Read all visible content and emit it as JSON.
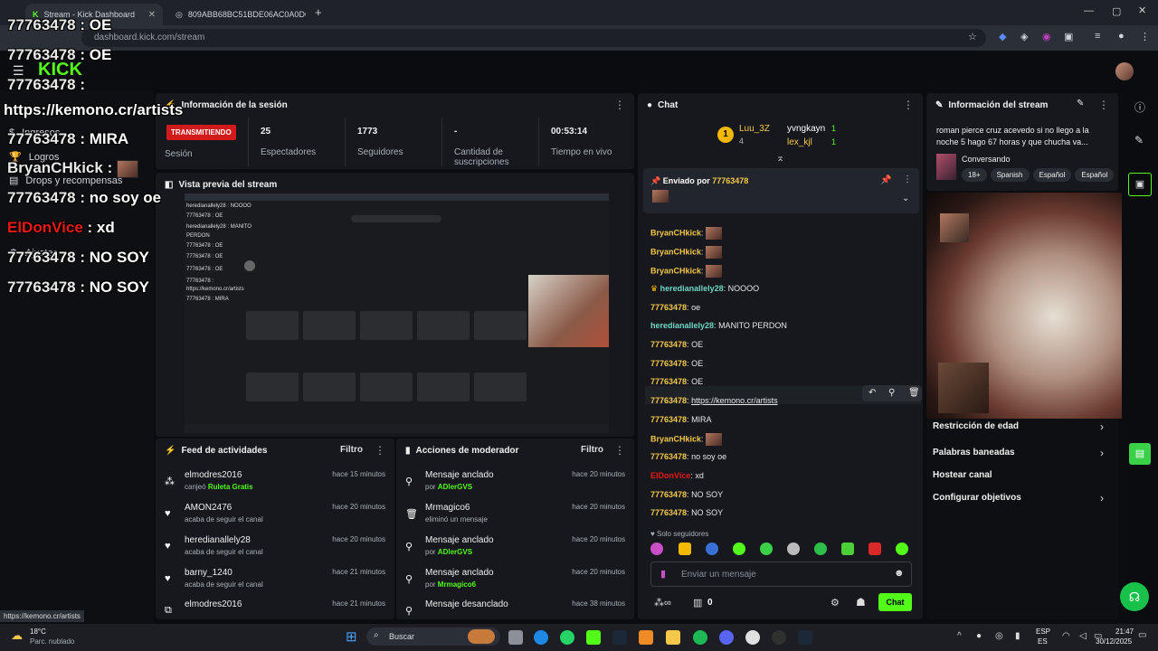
{
  "browser": {
    "tabs": [
      {
        "label": "Stream - Kick Dashboard"
      },
      {
        "label": "809ABB68BC51BDE06AC0A0DC"
      }
    ],
    "url": "dashboard.kick.com/stream"
  },
  "overlay": {
    "lines": [
      {
        "user": "77763478",
        "text": ": OE"
      },
      {
        "user": "77763478",
        "text": ": OE"
      },
      {
        "user": "77763478",
        "text": ":"
      },
      {
        "user": "",
        "text": "https://kemono.cr/artists"
      },
      {
        "user": "77763478",
        "text": ": MIRA"
      },
      {
        "user": "BryanCHkick",
        "text": ":"
      },
      {
        "user": "77763478",
        "text": ": no soy oe"
      },
      {
        "user": "ElDonVice",
        "text": ": xd"
      },
      {
        "user": "77763478",
        "text": ": NO SOY"
      },
      {
        "user": "77763478",
        "text": ": NO SOY"
      }
    ]
  },
  "sidebar": {
    "items": [
      "Ingresos",
      "Logros",
      "Drops y recompensas",
      "Ajustes"
    ]
  },
  "session": {
    "title": "Información de la sesión",
    "live": "TRANSMITIENDO",
    "session_label": "Sesión",
    "stats": [
      {
        "value": "25",
        "label": "Espectadores"
      },
      {
        "value": "1773",
        "label": "Seguidores"
      },
      {
        "value": "-",
        "label": "Cantidad de suscripciones"
      },
      {
        "value": "00:53:14",
        "label": "Tiempo en vivo"
      }
    ]
  },
  "preview": {
    "title": "Vista previa del stream",
    "lines": [
      "heredianallely28 : NOOOO",
      "77763478 : OE",
      "heredianallely28 : MANITO",
      "PERDON",
      "77763478 : OE",
      "77763478 : OE",
      "77763478 : OE",
      "77763478 :",
      "https://kemono.cr/artists",
      "77763478 : MIRA"
    ]
  },
  "activity": {
    "title": "Feed de actividades",
    "filter": "Filtro",
    "rows": [
      {
        "user": "elmodres2016",
        "detail": "canjeó",
        "bold": "Ruleta Gratis",
        "time": "hace 15 minutos"
      },
      {
        "user": "AMON2476",
        "detail": "acaba de seguir el canal",
        "bold": "",
        "time": "hace 20 minutos"
      },
      {
        "user": "heredianallely28",
        "detail": "acaba de seguir el canal",
        "bold": "",
        "time": "hace 20 minutos"
      },
      {
        "user": "barny_1240",
        "detail": "acaba de seguir el canal",
        "bold": "",
        "time": "hace 21 minutos"
      },
      {
        "user": "elmodres2016",
        "detail": "",
        "bold": "",
        "time": "hace 21 minutos"
      }
    ]
  },
  "mod": {
    "title": "Acciones de moderador",
    "filter": "Filtro",
    "rows": [
      {
        "action": "Mensaje anclado",
        "detail": "por",
        "bold": "ADlerGVS",
        "time": "hace 20 minutos"
      },
      {
        "action": "Mrmagico6",
        "detail": "eliminó un mensaje",
        "bold": "",
        "time": "hace 20 minutos"
      },
      {
        "action": "Mensaje anclado",
        "detail": "por",
        "bold": "ADlerGVS",
        "time": "hace 20 minutos"
      },
      {
        "action": "Mensaje anclado",
        "detail": "por",
        "bold": "Mrmagico6",
        "time": "hace 20 minutos"
      },
      {
        "action": "Mensaje desanclado",
        "detail": "",
        "bold": "",
        "time": "hace 38 minutos"
      }
    ]
  },
  "chat": {
    "title": "Chat",
    "top": [
      {
        "name": "Luu_3Z",
        "count": "4"
      },
      {
        "name": "yvngkayn",
        "count": "1"
      },
      {
        "name": "lex_kjl",
        "count": "1"
      }
    ],
    "pinned_label": "Enviado por",
    "pinned_user": "77763478",
    "messages": [
      {
        "user": "BryanCHkick",
        "text": "",
        "emote": true
      },
      {
        "user": "BryanCHkick",
        "text": "",
        "emote": true
      },
      {
        "user": "BryanCHkick",
        "text": "",
        "emote": true
      },
      {
        "user": "heredianallely28",
        "text": "NOOOO",
        "emote": false
      },
      {
        "user": "77763478",
        "text": "oe",
        "emote": false
      },
      {
        "user": "heredianallely28",
        "text": "MANITO PERDON",
        "emote": false
      },
      {
        "user": "77763478",
        "text": "OE",
        "emote": false
      },
      {
        "user": "77763478",
        "text": "OE",
        "emote": false
      },
      {
        "user": "77763478",
        "text": "OE",
        "emote": false
      },
      {
        "user": "77763478",
        "text": "https://kemono.cr/artists",
        "emote": false
      },
      {
        "user": "77763478",
        "text": "MIRA",
        "emote": false
      },
      {
        "user": "BryanCHkick",
        "text": "",
        "emote": true
      },
      {
        "user": "77763478",
        "text": "no soy oe",
        "emote": false
      },
      {
        "user": "ElDonVice",
        "text": "xd",
        "emote": false
      },
      {
        "user": "77763478",
        "text": "NO SOY",
        "emote": false
      },
      {
        "user": "77763478",
        "text": "NO SOY",
        "emote": false
      }
    ],
    "followers_only": "Solo seguidores",
    "placeholder": "Enviar un mensaje",
    "send": "Chat",
    "points": "0"
  },
  "stream_info": {
    "title": "Información del stream",
    "stream_title": "roman pierce cruz acevedo si no llego a la noche 5 hago 67 horas y que chucha va...",
    "category": "Conversando",
    "tags": [
      "18+",
      "Spanish",
      "Español",
      "Español"
    ],
    "links": [
      "Restricción de edad",
      "Palabras baneadas",
      "Hostear canal",
      "Configurar objetivos"
    ]
  },
  "status_url": "https://kemono.cr/artists",
  "taskbar": {
    "weather_temp": "18°C",
    "weather_desc": "Parc. nublado",
    "search": "Buscar",
    "lang1": "ESP",
    "lang2": "ES",
    "time": "21:47",
    "date": "30/12/2025"
  },
  "colors": {
    "accent": "#53fc18",
    "live": "#d11a1a",
    "bg": "#0b0c0f",
    "panel": "#16181d"
  }
}
